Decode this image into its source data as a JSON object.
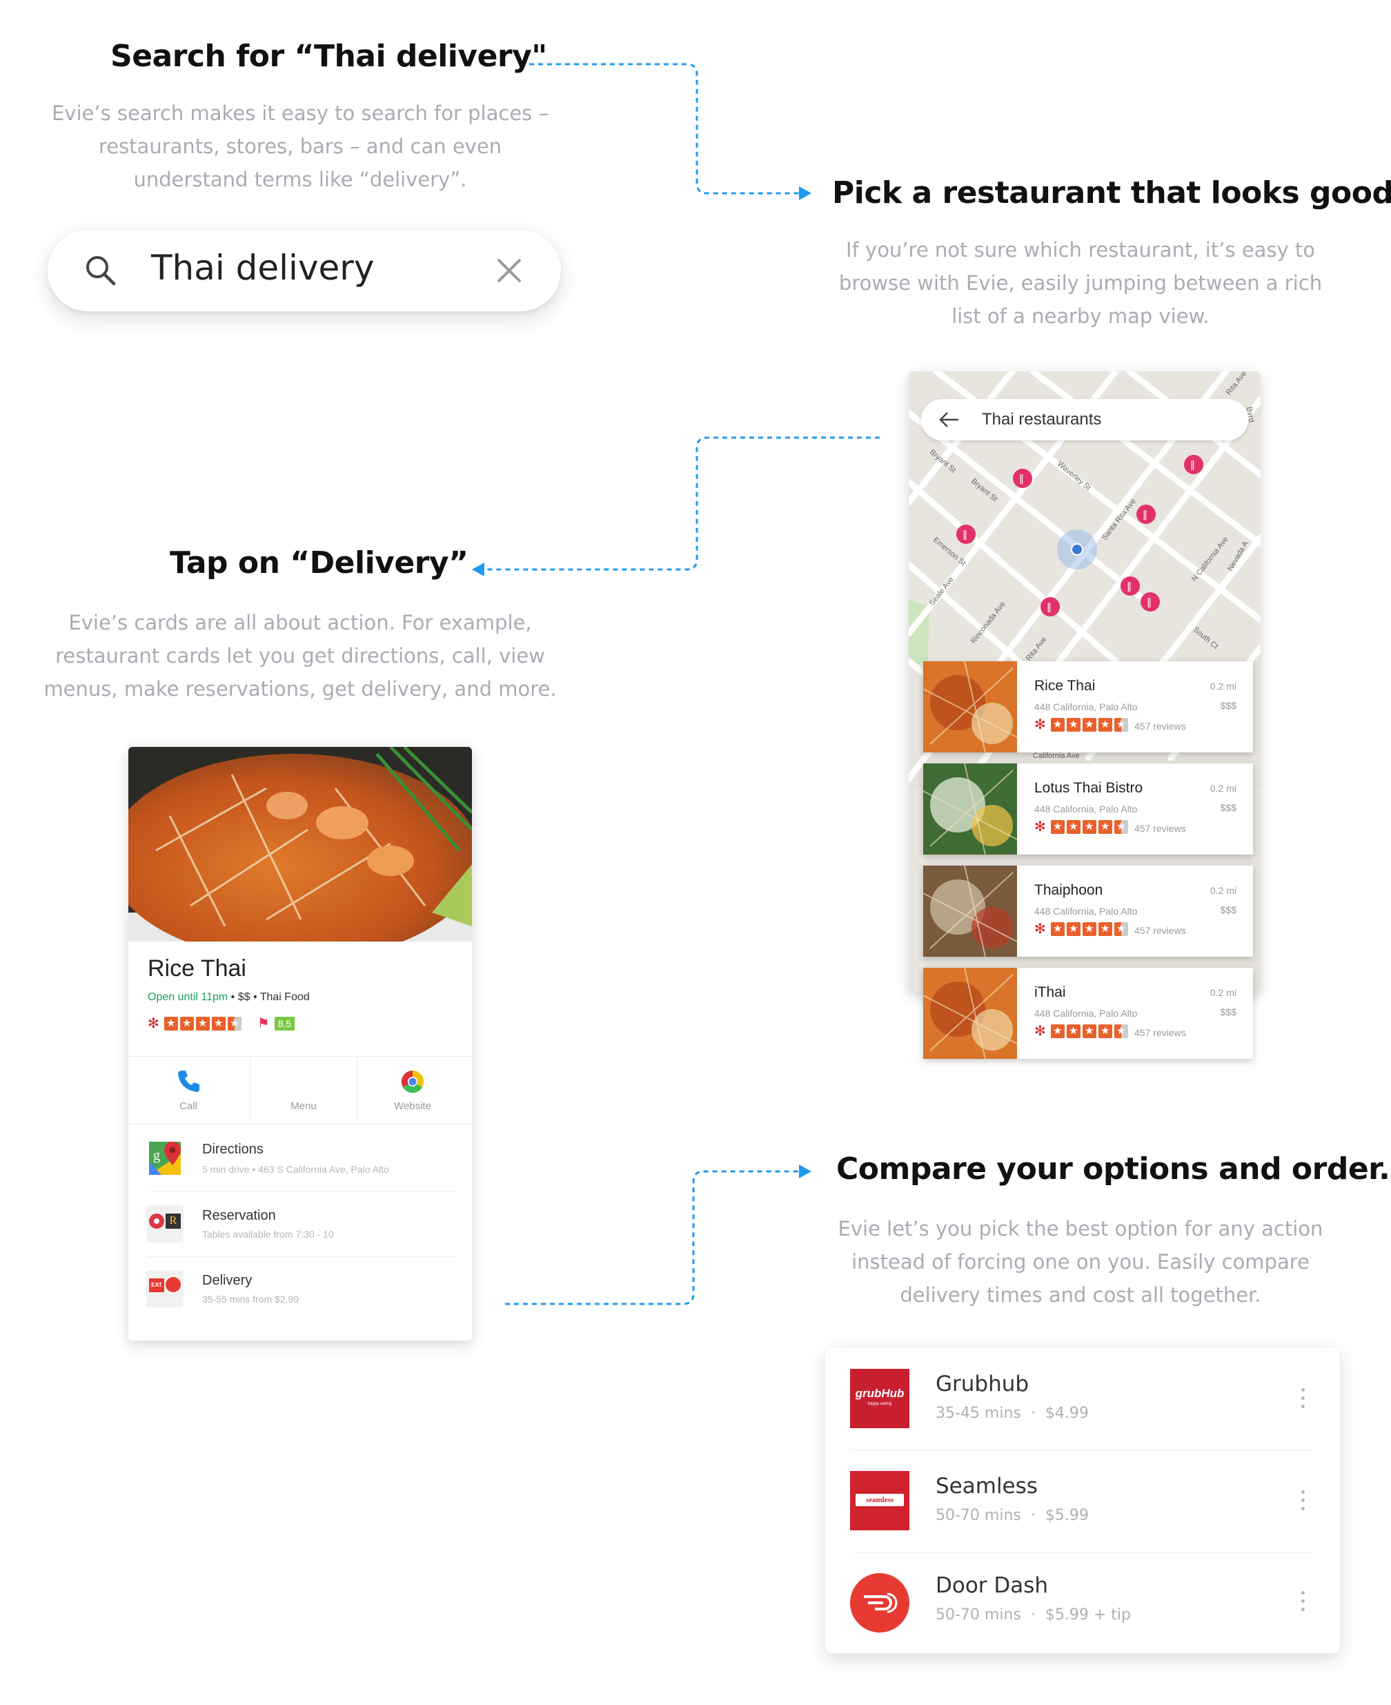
{
  "step1": {
    "title": "Search for “Thai delivery\"",
    "desc": [
      "Evie’s search makes it easy to search for places –",
      "restaurants, stores, bars – and can even",
      "understand terms like “delivery”."
    ],
    "search_query": "Thai delivery"
  },
  "step2": {
    "title": "Pick a restaurant that looks good.",
    "desc": [
      "If you’re not sure which restaurant, it’s easy to",
      "browse with Evie, easily jumping between a rich",
      "list of a nearby map view."
    ]
  },
  "map": {
    "search_label": "Thai restaurants",
    "streets": [
      "Bryant St",
      "Bryant St",
      "Waverley St",
      "Santa Rita Ave",
      "N California Ave",
      "Emerson St",
      "Seale Ave",
      "Rinconada Ave",
      "Rita Ave",
      "South Ct",
      "Nevada A",
      "California Ave",
      "Rita Ave",
      "Byrd"
    ]
  },
  "restaurants": [
    {
      "name": "Rice Thai",
      "address": "448 California, Palo Alto",
      "distance": "0.2 mi",
      "price": "$$$",
      "reviews": "457 reviews",
      "rating": 4.5
    },
    {
      "name": "Lotus Thai Bistro",
      "address": "448 California, Palo Alto",
      "distance": "0.2 mi",
      "price": "$$$",
      "reviews": "457 reviews",
      "rating": 4.5
    },
    {
      "name": "Thaiphoon",
      "address": "448 California, Palo Alto",
      "distance": "0.2 mi",
      "price": "$$$",
      "reviews": "457 reviews",
      "rating": 4.5
    },
    {
      "name": "iThai",
      "address": "448 California, Palo Alto",
      "distance": "0.2 mi",
      "price": "$$$",
      "reviews": "457 reviews",
      "rating": 4.5
    }
  ],
  "step3": {
    "title": "Tap on “Delivery”",
    "desc": [
      "Evie’s cards are all about action. For example,",
      "restaurant cards let you get directions, call, view",
      "menus, make reservations, get delivery, and more."
    ]
  },
  "detail": {
    "name": "Rice Thai",
    "open": "Open until 11pm",
    "price": "$$",
    "cuisine": "Thai Food",
    "foursquare_score": "8.5",
    "actions": {
      "call": "Call",
      "menu": "Menu",
      "website": "Website"
    },
    "rows": [
      {
        "title": "Directions",
        "sub": "5 min drive  •  463 S California Ave, Palo Alto"
      },
      {
        "title": "Reservation",
        "sub": "Tables available from 7:30 - 10"
      },
      {
        "title": "Delivery",
        "sub": "35-55 mins from $2.99"
      }
    ],
    "logo_text": {
      "google_maps": "g",
      "opentable": "R",
      "eat24": "EAT"
    }
  },
  "step4": {
    "title": "Compare your options and order.",
    "desc": [
      "Evie let’s you pick the best option for any action",
      "instead of forcing one on you. Easily compare",
      "delivery times and cost all together."
    ]
  },
  "providers": [
    {
      "name": "Grubhub",
      "time": "35-45 mins",
      "cost": "$4.99",
      "logo": "grubHub",
      "logo_sub": "happy eating",
      "color": "#c8202f"
    },
    {
      "name": "Seamless",
      "time": "50-70 mins",
      "cost": "$5.99",
      "logo": "seamless",
      "color": "#d0222d"
    },
    {
      "name": "Door Dash",
      "time": "50-70 mins",
      "cost": "$5.99 + tip",
      "color": "#e63a33"
    }
  ],
  "colors": {
    "accent_blue": "#1e9bef",
    "pin": "#e2316a",
    "yelp": "#d32323",
    "star": "#e8612c",
    "open_green": "#1aa260"
  }
}
